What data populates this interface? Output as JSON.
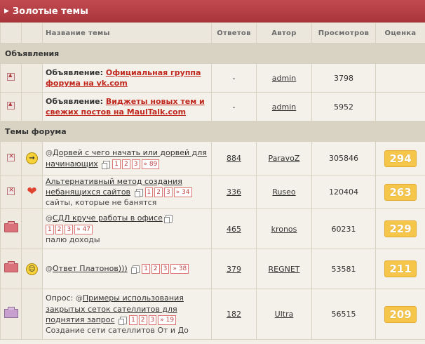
{
  "header": {
    "title": "Золотые темы"
  },
  "columns": {
    "name": "Название темы",
    "replies": "Ответов",
    "author": "Автор",
    "views": "Просмотров",
    "rating": "Оценка"
  },
  "sections": {
    "announcements": "Объявления",
    "topics": "Темы форума"
  },
  "announcements": [
    {
      "prefix": "Объявление: ",
      "title": "Официальная группа форума на vk.com",
      "replies": "-",
      "author": "admin",
      "views": "3798"
    },
    {
      "prefix": "Объявление: ",
      "title": "Виджеты новых тем и свежих постов на MaulTalk.com",
      "replies": "-",
      "author": "admin",
      "views": "5952"
    }
  ],
  "topics": [
    {
      "title": "Дорвей с чего начать или дорвей для начинающих",
      "pages": [
        "1",
        "2",
        "3",
        "» 89"
      ],
      "desc": "",
      "replies": "884",
      "author": "ParavoZ",
      "views": "305846",
      "rating": "294",
      "icon": "arrow-right-icon"
    },
    {
      "title": "Альтернативный метод создания небанящихся сайтов",
      "pages": [
        "1",
        "2",
        "3",
        "» 34"
      ],
      "desc": "сайты, которые не банятся",
      "replies": "336",
      "author": "Ruseo",
      "views": "120404",
      "rating": "263",
      "icon": "heart-icon"
    },
    {
      "title": "СДЛ круче работы в офисе",
      "pages": [
        "1",
        "2",
        "3",
        "» 47"
      ],
      "desc": "палю доходы",
      "replies": "465",
      "author": "kronos",
      "views": "60231",
      "rating": "229",
      "icon": ""
    },
    {
      "title": "Ответ Платонов)))",
      "pages": [
        "1",
        "2",
        "3",
        "» 38"
      ],
      "desc": "",
      "replies": "379",
      "author": "REGNET",
      "views": "53581",
      "rating": "211",
      "icon": "smile-icon"
    },
    {
      "prefix": "Опрос: ",
      "title": "Примеры использования закрытых сеток сателлитов для поднятия запрос",
      "pages": [
        "1",
        "2",
        "3",
        "» 19"
      ],
      "desc": "Создание сети сателлитов От и До",
      "replies": "182",
      "author": "Ultra",
      "views": "56515",
      "rating": "209",
      "icon": ""
    }
  ]
}
